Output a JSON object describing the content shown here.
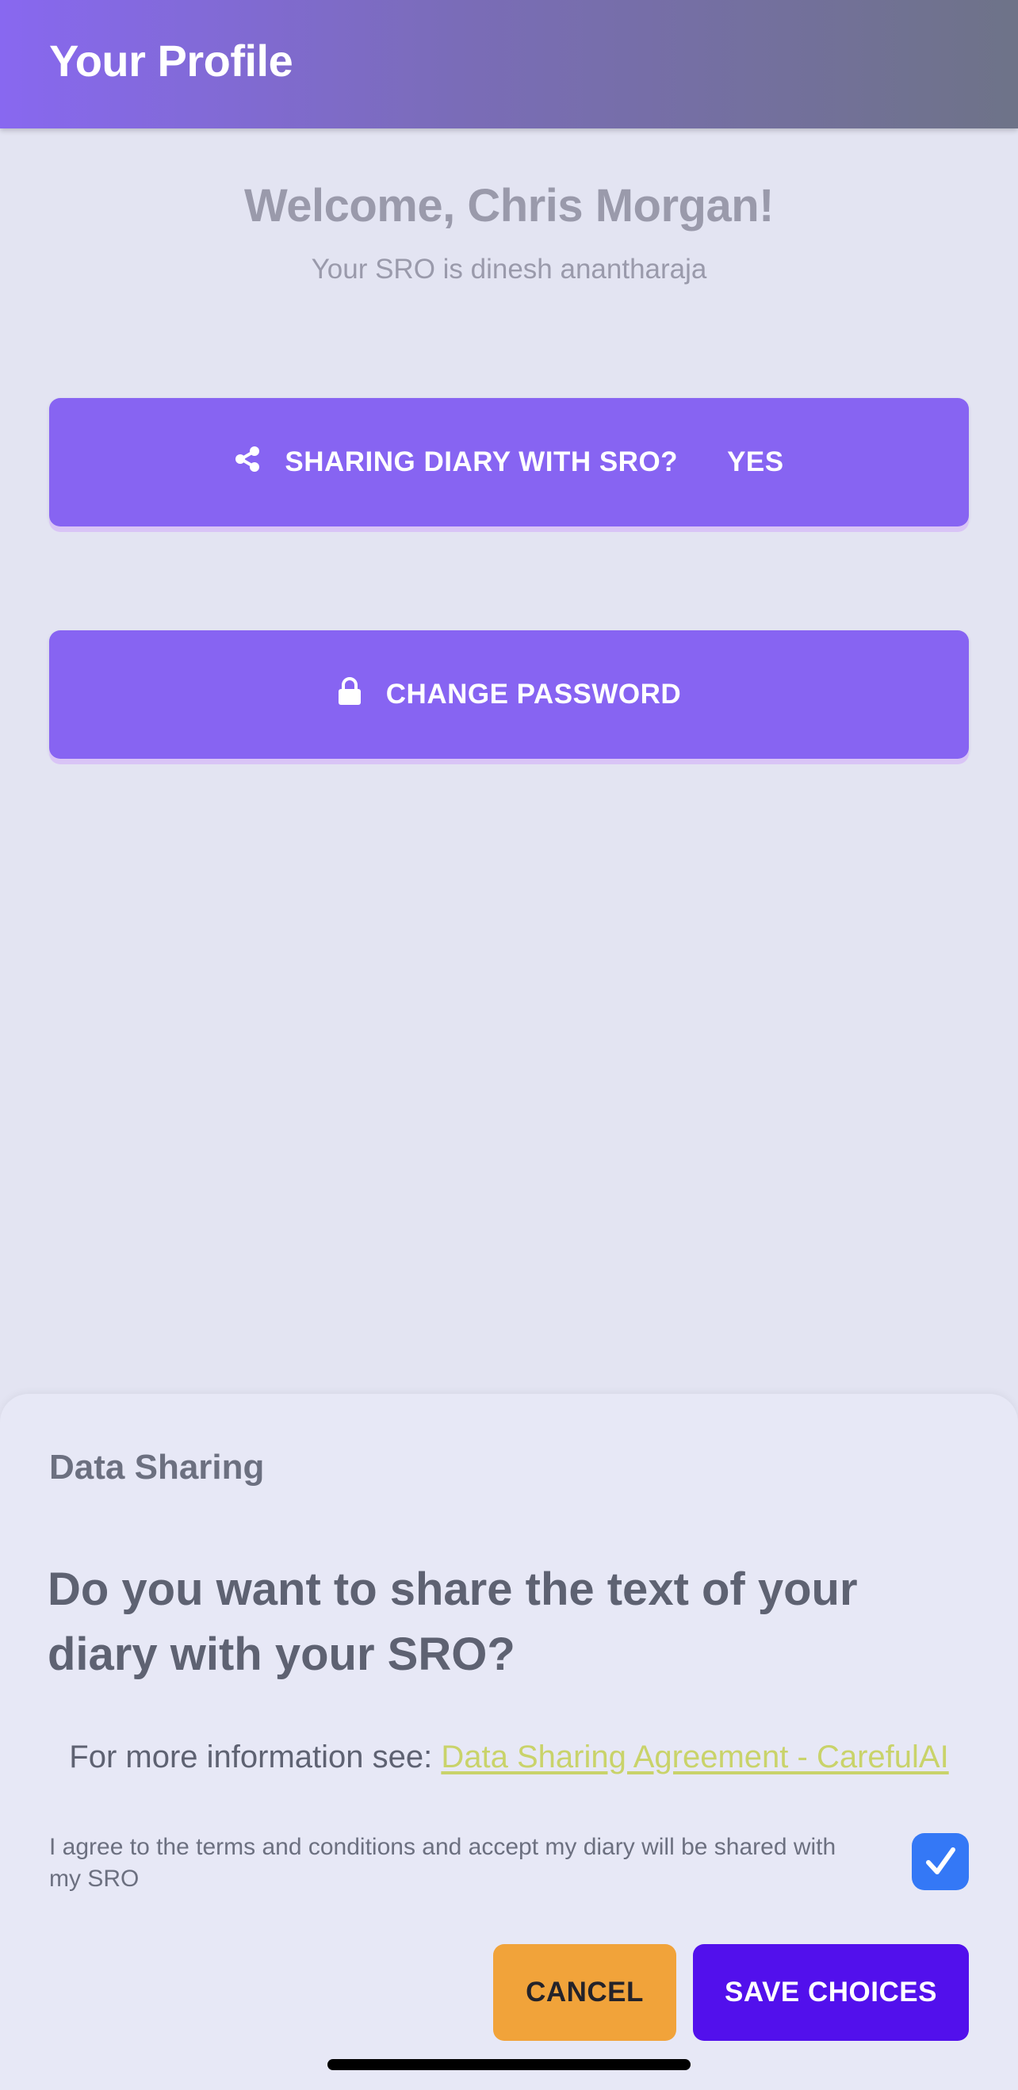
{
  "header": {
    "title": "Your Profile"
  },
  "profile": {
    "welcome": "Welcome, Chris Morgan!",
    "sro_line": "Your SRO is dinesh anantharaja"
  },
  "actions": {
    "sharing_label": "SHARING DIARY WITH SRO?",
    "sharing_value": "YES",
    "sharing_icon": "share-icon",
    "password_label": "CHANGE PASSWORD",
    "password_icon": "lock-icon"
  },
  "sheet": {
    "title": "Data Sharing",
    "question": "Do you want to share the text of your diary with your SRO?",
    "more_info_prefix": "For more information see:",
    "link_text": "Data Sharing Agreement - CarefulAI",
    "agree_text": "I agree to the terms and conditions and accept my diary will be shared with my SRO",
    "agree_checked": true,
    "cancel_label": "CANCEL",
    "save_label": "SAVE CHOICES"
  },
  "colors": {
    "primary": "#8764f2",
    "cancel": "#f1a33a",
    "save": "#5210ec",
    "checkbox": "#3478f6",
    "link": "#c9d36a"
  }
}
